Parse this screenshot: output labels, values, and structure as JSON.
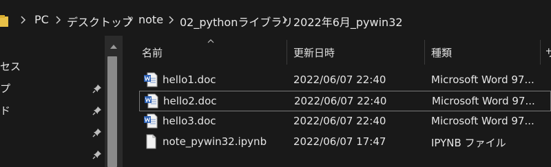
{
  "address_bar": {
    "crumbs": [
      "PC",
      "デスクトップ",
      "note",
      "02_pythonライブラリ",
      "2022年6月_pywin32"
    ]
  },
  "nav": {
    "items": [
      {
        "label": "セス",
        "pinned": false
      },
      {
        "label": "プ",
        "pinned": true
      },
      {
        "label": "ド",
        "pinned": true
      },
      {
        "label": "",
        "pinned": true
      },
      {
        "label": "",
        "pinned": true
      }
    ]
  },
  "columns": {
    "name": "名前",
    "date": "更新日時",
    "type": "種類",
    "size": "サ"
  },
  "files": [
    {
      "name": "hello1.doc",
      "date": "2022/06/07 22:40",
      "type": "Microsoft Word 97...",
      "icon": "word-doc-icon",
      "selected": false
    },
    {
      "name": "hello2.doc",
      "date": "2022/06/07 22:40",
      "type": "Microsoft Word 97...",
      "icon": "word-doc-icon",
      "selected": true
    },
    {
      "name": "hello3.doc",
      "date": "2022/06/07 22:40",
      "type": "Microsoft Word 97...",
      "icon": "word-doc-icon",
      "selected": false
    },
    {
      "name": "note_pywin32.ipynb",
      "date": "2022/06/07 17:47",
      "type": "IPYNB ファイル",
      "icon": "generic-file-icon",
      "selected": false
    }
  ],
  "colors": {
    "background": "#191919",
    "selection_border": "#7a7a7a",
    "folder_yellow": "#e8c148",
    "word_blue": "#2b5fb3"
  }
}
